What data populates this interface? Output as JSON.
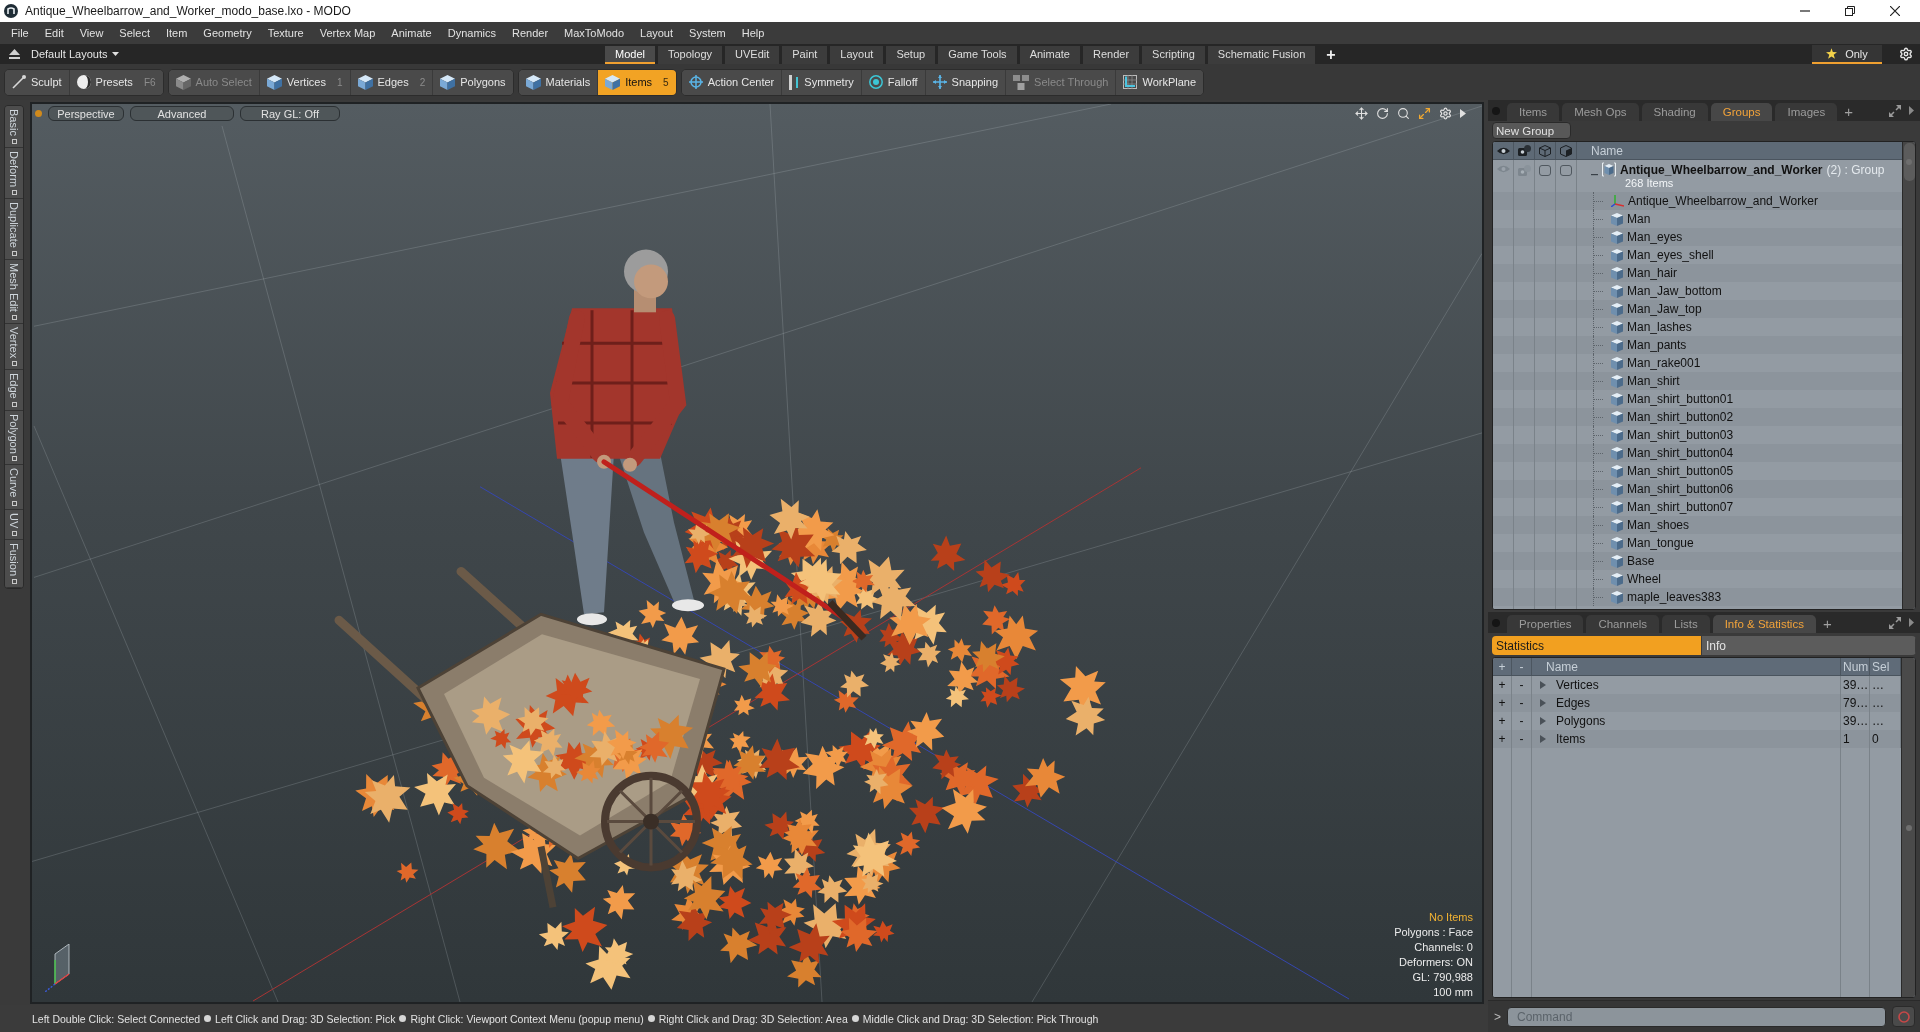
{
  "window": {
    "title": "Antique_Wheelbarrow_and_Worker_modo_base.lxo - MODO"
  },
  "menu": [
    "File",
    "Edit",
    "View",
    "Select",
    "Item",
    "Geometry",
    "Texture",
    "Vertex Map",
    "Animate",
    "Dynamics",
    "Render",
    "MaxToModo",
    "Layout",
    "System",
    "Help"
  ],
  "layout_bar": {
    "layouts_menu": "Default Layouts",
    "tabs": [
      {
        "label": "Model",
        "selected": true
      },
      {
        "label": "Topology",
        "selected": false
      },
      {
        "label": "UVEdit",
        "selected": false
      },
      {
        "label": "Paint",
        "selected": false
      },
      {
        "label": "Layout",
        "selected": false
      },
      {
        "label": "Setup",
        "selected": false
      },
      {
        "label": "Game Tools",
        "selected": false
      },
      {
        "label": "Animate",
        "selected": false
      },
      {
        "label": "Render",
        "selected": false
      },
      {
        "label": "Scripting",
        "selected": false
      },
      {
        "label": "Schematic Fusion",
        "selected": false
      }
    ],
    "add_tab": "+",
    "only_button": {
      "label": "Only",
      "on": true
    }
  },
  "toolbar": {
    "groups": [
      {
        "items": [
          {
            "label": "Sculpt",
            "selected": false,
            "disabled": false
          },
          {
            "label": "Presets",
            "shortcut": "F6",
            "selected": false,
            "disabled": false
          }
        ]
      },
      {
        "items": [
          {
            "label": "Auto Select",
            "selected": false,
            "disabled": true
          },
          {
            "label": "Vertices",
            "shortcut": "1",
            "selected": false,
            "disabled": false
          },
          {
            "label": "Edges",
            "shortcut": "2",
            "selected": false,
            "disabled": false
          },
          {
            "label": "Polygons",
            "selected": false,
            "disabled": false
          }
        ]
      },
      {
        "items": [
          {
            "label": "Materials",
            "selected": false,
            "disabled": false
          },
          {
            "label": "Items",
            "shortcut": "5",
            "selected": true,
            "disabled": false
          }
        ]
      },
      {
        "items": [
          {
            "label": "Action Center",
            "selected": false,
            "disabled": false
          },
          {
            "label": "Symmetry",
            "selected": false,
            "disabled": false
          },
          {
            "label": "Falloff",
            "selected": false,
            "disabled": false
          },
          {
            "label": "Snapping",
            "selected": false,
            "disabled": false
          },
          {
            "label": "Select Through",
            "selected": false,
            "disabled": true
          },
          {
            "label": "WorkPlane",
            "selected": false,
            "disabled": false
          }
        ]
      }
    ]
  },
  "tool_tabs": [
    "Basic",
    "Deform",
    "Duplicate",
    "Mesh Edit",
    "Vertex",
    "Edge",
    "Polygon",
    "Curve",
    "UV",
    "Fusion"
  ],
  "viewport": {
    "view_buttons": [
      "Perspective",
      "Advanced",
      "Ray GL: Off"
    ],
    "info": {
      "selection": "No Items",
      "lines": [
        "Polygons : Face",
        "Channels: 0",
        "Deformers: ON",
        "GL: 790,988",
        "100 mm"
      ]
    }
  },
  "status_bar": {
    "hints": [
      "Left Double Click: Select Connected",
      "Left Click and Drag: 3D Selection: Pick",
      "Right Click: Viewport Context Menu (popup menu)",
      "Right Click and Drag: 3D Selection: Area",
      "Middle Click and Drag: 3D Selection: Pick Through"
    ]
  },
  "groups_panel": {
    "tabs": [
      {
        "label": "Items",
        "selected": false
      },
      {
        "label": "Mesh Ops",
        "selected": false
      },
      {
        "label": "Shading",
        "selected": false
      },
      {
        "label": "Groups",
        "selected": true
      },
      {
        "label": "Images",
        "selected": false
      }
    ],
    "add_tab": "+",
    "new_group_button": "New Group",
    "name_column": "Name",
    "group": {
      "name": "Antique_Wheelbarrow_and_Worker",
      "suffix": "(2) : Group",
      "subtitle": "268 Items",
      "expanded": true,
      "toggles": [
        {
          "checked": false
        },
        {
          "checked": false
        }
      ],
      "children": [
        {
          "name": "Antique_Wheelbarrow_and_Worker",
          "kind": "locator"
        },
        {
          "name": "Man",
          "kind": "mesh"
        },
        {
          "name": "Man_eyes",
          "kind": "mesh"
        },
        {
          "name": "Man_eyes_shell",
          "kind": "mesh"
        },
        {
          "name": "Man_hair",
          "kind": "mesh"
        },
        {
          "name": "Man_Jaw_bottom",
          "kind": "mesh"
        },
        {
          "name": "Man_Jaw_top",
          "kind": "mesh"
        },
        {
          "name": "Man_lashes",
          "kind": "mesh"
        },
        {
          "name": "Man_pants",
          "kind": "mesh"
        },
        {
          "name": "Man_rake001",
          "kind": "mesh"
        },
        {
          "name": "Man_shirt",
          "kind": "mesh"
        },
        {
          "name": "Man_shirt_button01",
          "kind": "mesh"
        },
        {
          "name": "Man_shirt_button02",
          "kind": "mesh"
        },
        {
          "name": "Man_shirt_button03",
          "kind": "mesh"
        },
        {
          "name": "Man_shirt_button04",
          "kind": "mesh"
        },
        {
          "name": "Man_shirt_button05",
          "kind": "mesh"
        },
        {
          "name": "Man_shirt_button06",
          "kind": "mesh"
        },
        {
          "name": "Man_shirt_button07",
          "kind": "mesh"
        },
        {
          "name": "Man_shoes",
          "kind": "mesh"
        },
        {
          "name": "Man_tongue",
          "kind": "mesh"
        },
        {
          "name": "Base",
          "kind": "mesh"
        },
        {
          "name": "Wheel",
          "kind": "mesh"
        },
        {
          "name": "maple_leaves383",
          "kind": "mesh"
        }
      ]
    }
  },
  "stats_panel": {
    "tabs": [
      {
        "label": "Properties",
        "selected": false
      },
      {
        "label": "Channels",
        "selected": false
      },
      {
        "label": "Lists",
        "selected": false
      },
      {
        "label": "Info & Statistics",
        "selected": true
      }
    ],
    "add_tab": "+",
    "subtabs": [
      {
        "label": "Statistics",
        "selected": true
      },
      {
        "label": "Info",
        "selected": false
      }
    ],
    "columns": [
      "+",
      "-",
      "Name",
      "Num",
      "Sel"
    ],
    "rows": [
      {
        "add": "+",
        "remove": "-",
        "name": "Vertices",
        "num": "39…",
        "sel": "…",
        "expanded": false
      },
      {
        "add": "+",
        "remove": "-",
        "name": "Edges",
        "num": "79…",
        "sel": "…",
        "expanded": false
      },
      {
        "add": "+",
        "remove": "-",
        "name": "Polygons",
        "num": "39…",
        "sel": "…",
        "expanded": false
      },
      {
        "add": "+",
        "remove": "-",
        "name": "Items",
        "num": "1",
        "sel": "0",
        "expanded": false
      }
    ]
  },
  "command": {
    "prompt": ">",
    "placeholder": "Command"
  }
}
